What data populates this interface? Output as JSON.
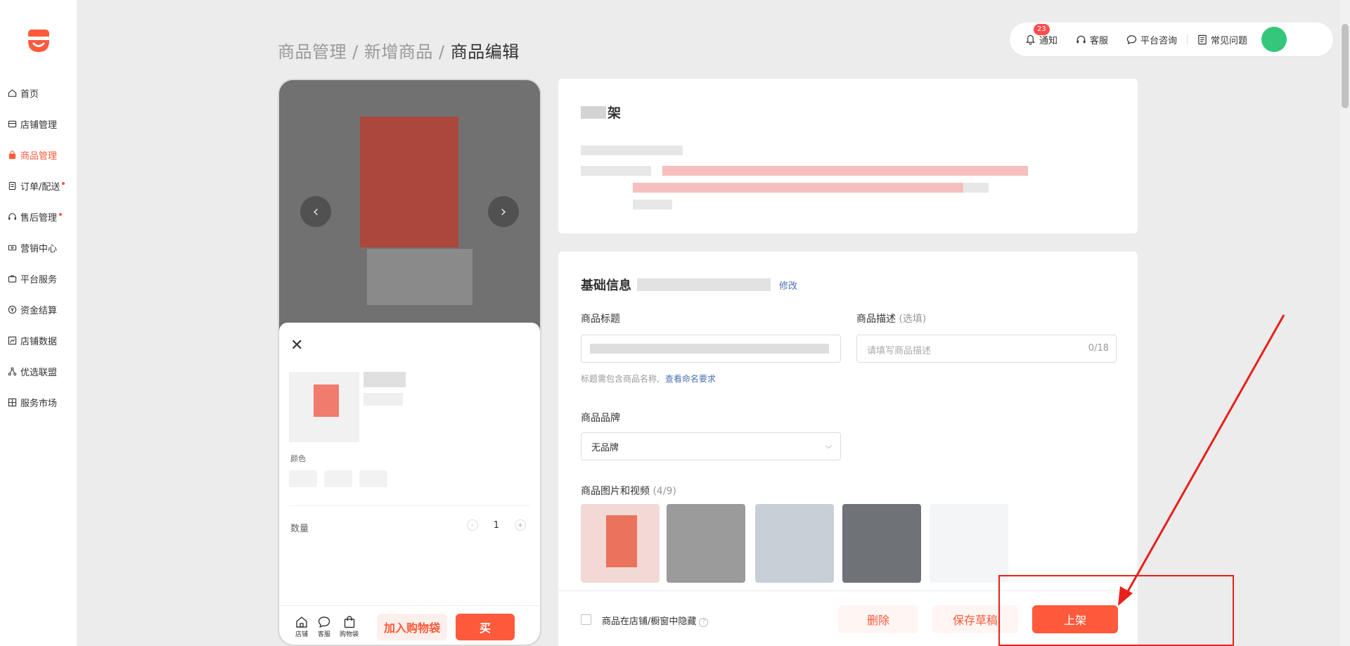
{
  "colors": {
    "accent": "#ff5a3c",
    "link": "#4a6fb3",
    "annotation": "#e8201a"
  },
  "sidebar": {
    "items": [
      {
        "label": "首页",
        "icon": "home-icon",
        "dot": false
      },
      {
        "label": "店铺管理",
        "icon": "store-icon",
        "dot": false
      },
      {
        "label": "商品管理",
        "icon": "bag-icon",
        "dot": false,
        "active": true
      },
      {
        "label": "订单/配送",
        "icon": "order-icon",
        "dot": true
      },
      {
        "label": "售后管理",
        "icon": "headset-icon",
        "dot": true
      },
      {
        "label": "营销中心",
        "icon": "ticket-icon",
        "dot": false
      },
      {
        "label": "平台服务",
        "icon": "briefcase-icon",
        "dot": false
      },
      {
        "label": "资金结算",
        "icon": "yen-icon",
        "dot": false
      },
      {
        "label": "店铺数据",
        "icon": "chart-icon",
        "dot": false
      },
      {
        "label": "优选联盟",
        "icon": "network-icon",
        "dot": false
      },
      {
        "label": "服务市场",
        "icon": "grid-icon",
        "dot": false
      }
    ]
  },
  "breadcrumb": {
    "part1": "商品管理",
    "sep": "/",
    "part2": "新增商品",
    "current": "商品编辑"
  },
  "topbar": {
    "notify": "通知",
    "notify_count": "23",
    "service": "客服",
    "consult": "平台咨询",
    "faq": "常见问题"
  },
  "preview": {
    "color_label": "颜色",
    "qty_label": "数量",
    "qty_value": "1",
    "minus": "-",
    "plus": "+",
    "nav": {
      "store": "店铺",
      "service": "客服",
      "cart": "购物袋"
    },
    "add_cart": "加入购物袋",
    "buy": "买"
  },
  "card1": {
    "title_visible": "架"
  },
  "form": {
    "section_title": "基础信息",
    "edit": "修改",
    "title_label": "商品标题",
    "desc_label": "商品描述",
    "desc_hint": "(选填)",
    "desc_placeholder": "请填写商品描述",
    "desc_counter": "0/18",
    "title_hint": "标题需包含商品名称,",
    "title_hint_link": "查看命名要求",
    "brand_label": "商品品牌",
    "brand_value": "无品牌",
    "media_label": "商品图片和视频",
    "media_count": "(4/9)"
  },
  "footer": {
    "hide_label": "商品在店铺/橱窗中隐藏",
    "delete": "删除",
    "save_draft": "保存草稿",
    "publish": "上架"
  }
}
